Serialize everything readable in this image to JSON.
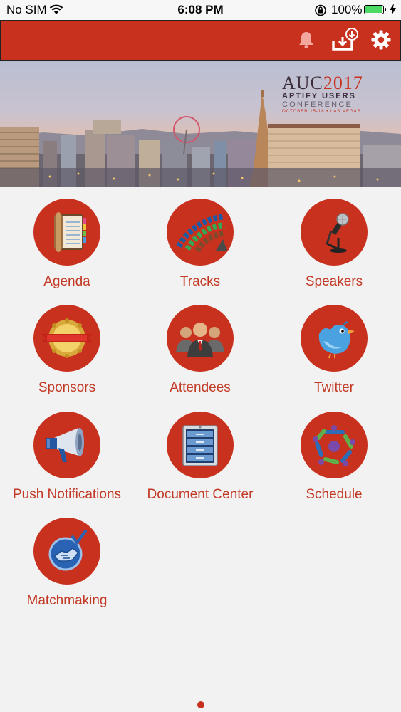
{
  "status_bar": {
    "carrier": "No SIM",
    "time": "6:08 PM",
    "battery": "100%"
  },
  "header": {
    "icons": [
      "bell-icon",
      "download-icon",
      "gear-icon"
    ]
  },
  "banner": {
    "logo_line1": "AUC",
    "logo_year": "2017",
    "logo_line2": "APTIFY USERS",
    "logo_line3": "CONFERENCE",
    "logo_line4": "OCTOBER 15-18 • LAS VEGAS"
  },
  "menu": {
    "items": [
      {
        "label": "Agenda",
        "icon": "agenda-icon"
      },
      {
        "label": "Tracks",
        "icon": "tracks-icon"
      },
      {
        "label": "Speakers",
        "icon": "microphone-icon"
      },
      {
        "label": "Sponsors",
        "icon": "sponsor-badge-icon"
      },
      {
        "label": "Attendees",
        "icon": "people-icon"
      },
      {
        "label": "Twitter",
        "icon": "twitter-bird-icon"
      },
      {
        "label": "Push Notifications",
        "icon": "megaphone-icon"
      },
      {
        "label": "Document Center",
        "icon": "file-cabinet-icon"
      },
      {
        "label": "Schedule",
        "icon": "schedule-icon"
      },
      {
        "label": "Matchmaking",
        "icon": "handshake-icon"
      }
    ]
  },
  "colors": {
    "accent": "#c9311f",
    "label": "#c23a25",
    "background": "#f3f2f2"
  },
  "pagination": {
    "pages": 1,
    "current": 1
  }
}
